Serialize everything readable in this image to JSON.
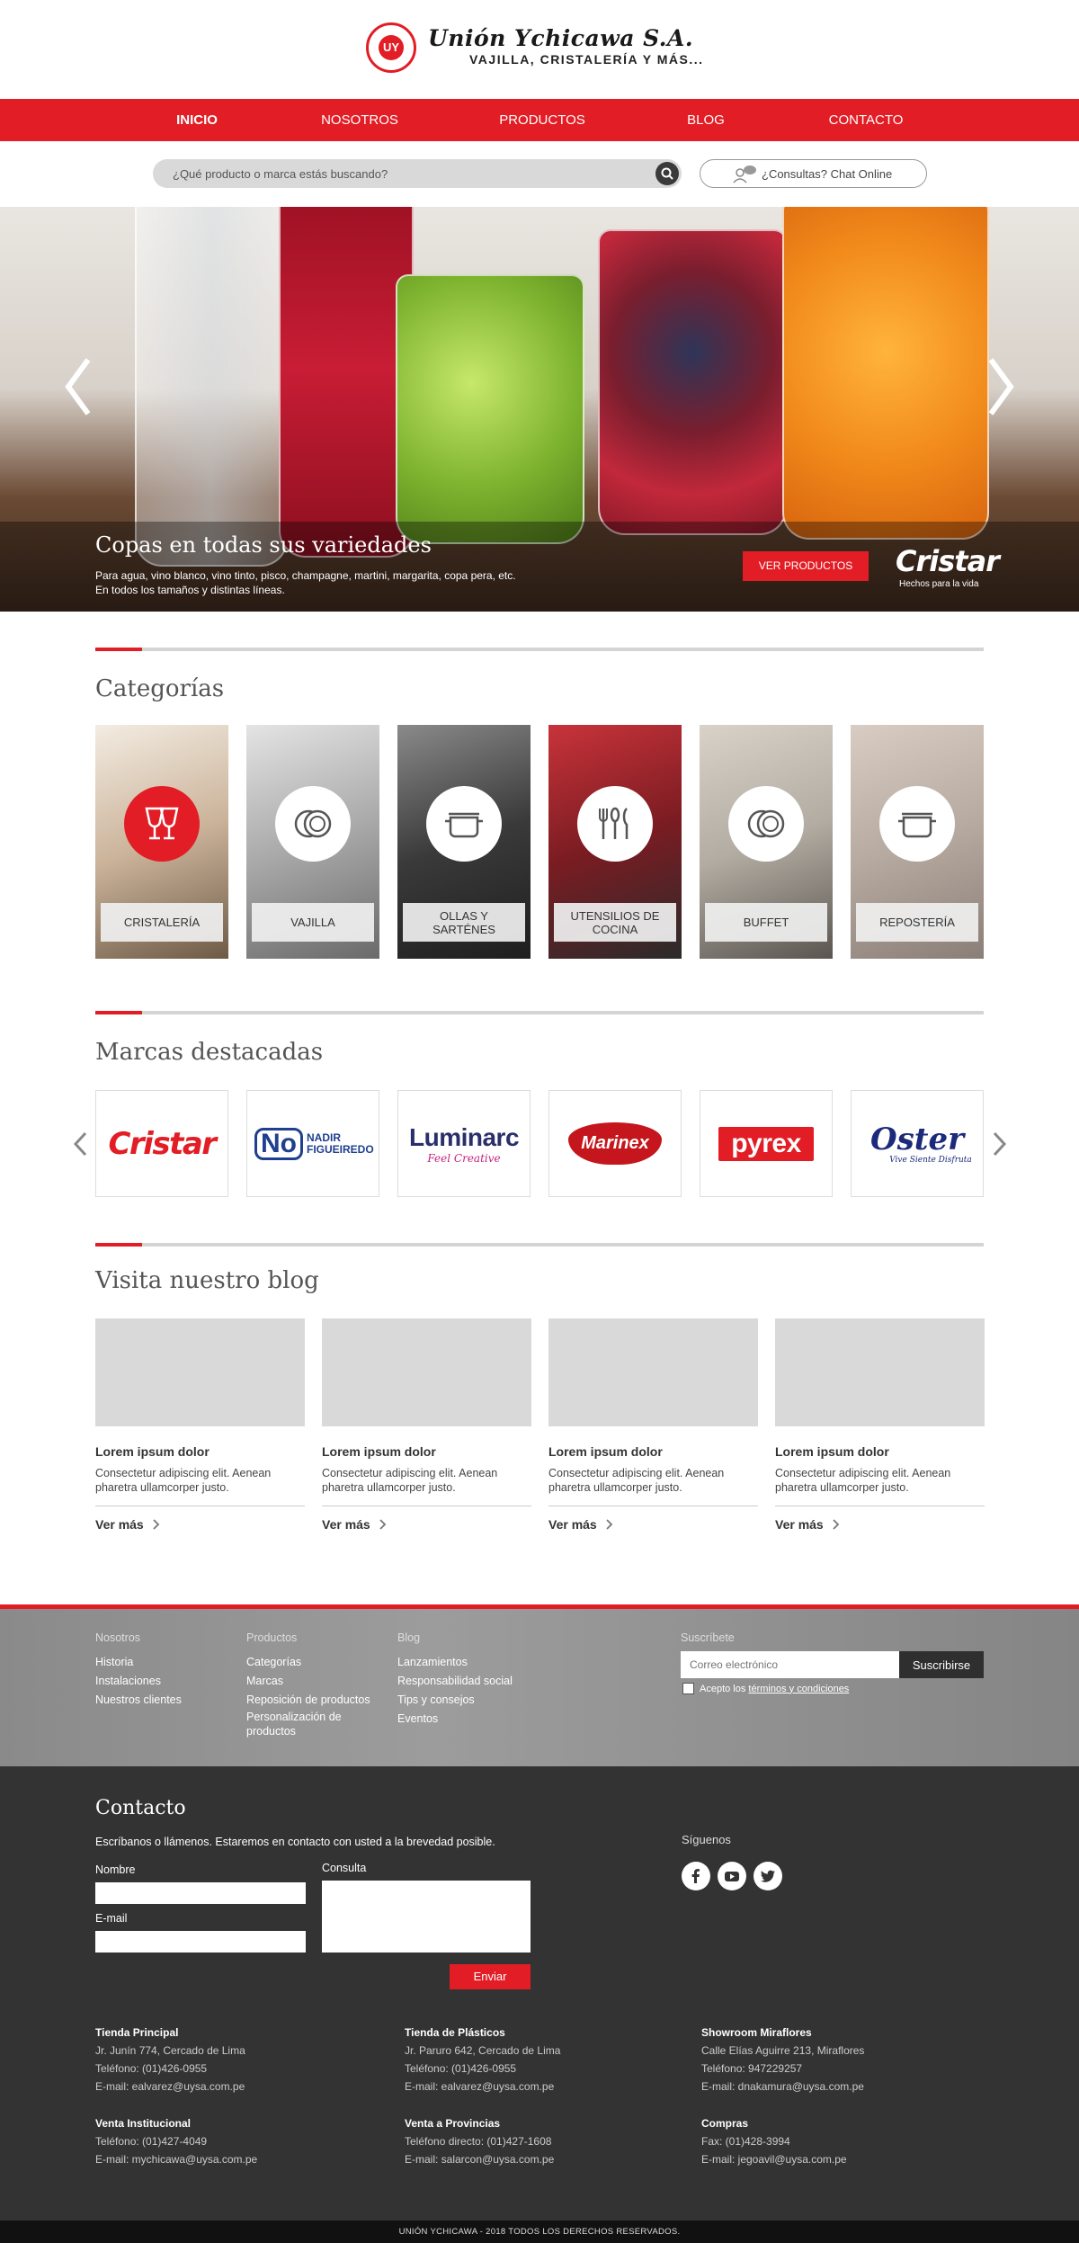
{
  "header": {
    "brand_name": "Unión Ychicawa S.A.",
    "tagline": "VAJILLA, CRISTALERÍA Y MÁS...",
    "seal_text": "UY"
  },
  "nav": {
    "items": [
      {
        "label": "INICIO",
        "active": true
      },
      {
        "label": "NOSOTROS"
      },
      {
        "label": "PRODUCTOS"
      },
      {
        "label": "BLOG"
      },
      {
        "label": "CONTACTO"
      }
    ]
  },
  "search": {
    "placeholder": "¿Qué producto o marca estás buscando?",
    "icon": "search-icon"
  },
  "chat": {
    "label": "¿Consultas? Chat Online",
    "icon": "chat-user-icon"
  },
  "hero": {
    "title": "Copas en todas sus variedades",
    "subtitle_line1": "Para agua, vino blanco, vino tinto, pisco, champagne, martini, margarita, copa pera, etc.",
    "subtitle_line2": "En todos los tamaños y distintas líneas.",
    "cta": "VER PRODUCTOS",
    "brand": "Cristar",
    "brand_tag": "Hechos para la vida"
  },
  "categories": {
    "title": "Categorías",
    "items": [
      {
        "label": "CRISTALERÍA",
        "icon": "wine-glasses-icon"
      },
      {
        "label": "VAJILLA",
        "icon": "plate-icon"
      },
      {
        "label": "OLLAS Y SARTÉNES",
        "icon": "pot-icon"
      },
      {
        "label": "UTENSILIOS DE COCINA",
        "icon": "cutlery-icon"
      },
      {
        "label": "BUFFET",
        "icon": "plate-icon"
      },
      {
        "label": "REPOSTERÍA",
        "icon": "pot-icon"
      }
    ]
  },
  "brands": {
    "title": "Marcas destacadas",
    "items": [
      {
        "name": "Cristar",
        "color": "#e21d25"
      },
      {
        "name": "NADIR FIGUEIREDO",
        "mark": "No",
        "color": "#1f3f8f"
      },
      {
        "name": "Luminarc",
        "tag": "Feel Creative",
        "color": "#2a2f6b"
      },
      {
        "name": "Marinex",
        "color": "#c4161c"
      },
      {
        "name": "pyrex",
        "color": "#e21d25"
      },
      {
        "name": "Oster",
        "tag": "Vive Siente Disfruta",
        "color": "#1b2a7a"
      }
    ]
  },
  "blog": {
    "title": "Visita nuestro blog",
    "posts": [
      {
        "title": "Lorem ipsum dolor",
        "desc": "Consectetur adipiscing elit. Aenean pharetra ullamcorper justo.",
        "more": "Ver más"
      },
      {
        "title": "Lorem ipsum dolor",
        "desc": "Consectetur adipiscing elit. Aenean pharetra ullamcorper justo.",
        "more": "Ver más"
      },
      {
        "title": "Lorem ipsum dolor",
        "desc": "Consectetur adipiscing elit. Aenean pharetra ullamcorper justo.",
        "more": "Ver más"
      },
      {
        "title": "Lorem ipsum dolor",
        "desc": "Consectetur adipiscing elit. Aenean pharetra ullamcorper justo.",
        "more": "Ver más"
      }
    ]
  },
  "footer_links": {
    "nosotros": {
      "heading": "Nosotros",
      "items": [
        "Historia",
        "Instalaciones",
        "Nuestros clientes"
      ]
    },
    "productos": {
      "heading": "Productos",
      "items": [
        "Categorías",
        "Marcas",
        "Reposición de productos",
        "Personalización de productos"
      ]
    },
    "blog": {
      "heading": "Blog",
      "items": [
        "Lanzamientos",
        "Responsabilidad social",
        "Tips y consejos",
        "Eventos"
      ]
    },
    "subscribe": {
      "heading": "Suscríbete",
      "placeholder": "Correo electrónico",
      "button": "Suscribirse",
      "terms_prefix": "Acepto los ",
      "terms_link": "términos y condiciones"
    }
  },
  "contact": {
    "title": "Contacto",
    "subtitle": "Escríbanos o llámenos. Estaremos en contacto con usted a la brevedad posible.",
    "name_label": "Nombre",
    "email_label": "E-mail",
    "query_label": "Consulta",
    "send": "Enviar",
    "social_heading": "Síguenos",
    "social": [
      "facebook-icon",
      "youtube-icon",
      "twitter-icon"
    ]
  },
  "stores": [
    {
      "name": "Tienda Principal",
      "lines": [
        "Jr. Junín 774, Cercado de Lima",
        "Teléfono: (01)426-0955",
        "E-mail: ealvarez@uysa.com.pe"
      ]
    },
    {
      "name": "Tienda de Plásticos",
      "lines": [
        "Jr. Paruro 642, Cercado de Lima",
        "Teléfono: (01)426-0955",
        "E-mail: ealvarez@uysa.com.pe"
      ]
    },
    {
      "name": "Showroom Miraflores",
      "lines": [
        "Calle Elías Aguirre 213, Miraflores",
        "Teléfono: 947229257",
        "E-mail: dnakamura@uysa.com.pe"
      ]
    },
    {
      "name": "Venta Institucional",
      "lines": [
        "Teléfono: (01)427-4049",
        "E-mail: mychicawa@uysa.com.pe"
      ]
    },
    {
      "name": "Venta a Provincias",
      "lines": [
        "Teléfono directo: (01)427-1608",
        "E-mail: salarcon@uysa.com.pe"
      ]
    },
    {
      "name": "Compras",
      "lines": [
        "Fax: (01)428-3994",
        "E-mail: jegoavil@uysa.com.pe"
      ]
    }
  ],
  "copyright": "UNIÓN YCHICAWA - 2018 TODOS LOS DERECHOS RESERVADOS.",
  "colors": {
    "accent": "#e21d25",
    "dark": "#333333"
  }
}
